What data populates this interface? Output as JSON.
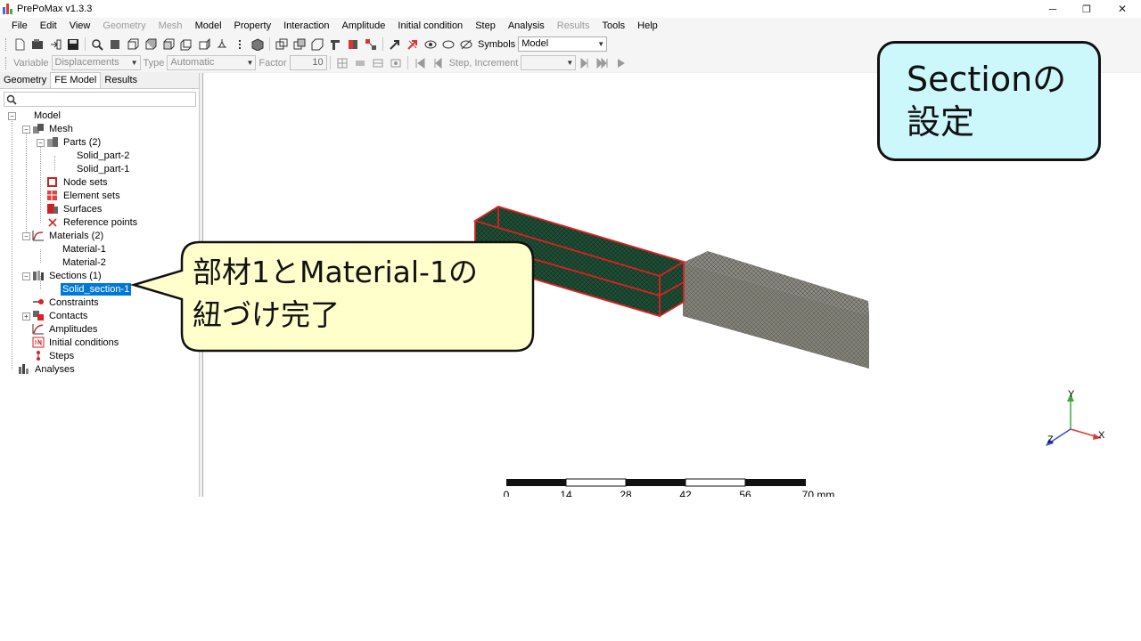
{
  "window": {
    "title": "PrePoMax v1.3.3",
    "minimize": "─",
    "maximize": "❐",
    "close": "✕"
  },
  "menu": [
    {
      "label": "File",
      "enabled": true
    },
    {
      "label": "Edit",
      "enabled": true
    },
    {
      "label": "View",
      "enabled": true
    },
    {
      "label": "Geometry",
      "enabled": false
    },
    {
      "label": "Mesh",
      "enabled": false
    },
    {
      "label": "Model",
      "enabled": true
    },
    {
      "label": "Property",
      "enabled": true
    },
    {
      "label": "Interaction",
      "enabled": true
    },
    {
      "label": "Amplitude",
      "enabled": true
    },
    {
      "label": "Initial condition",
      "enabled": true
    },
    {
      "label": "Step",
      "enabled": true
    },
    {
      "label": "Analysis",
      "enabled": true
    },
    {
      "label": "Results",
      "enabled": false
    },
    {
      "label": "Tools",
      "enabled": true
    },
    {
      "label": "Help",
      "enabled": true
    }
  ],
  "toolbar1": {
    "symbols_label": "Symbols",
    "symbols_value": "Model"
  },
  "toolbar2": {
    "variable_label": "Variable",
    "variable_value": "Displacements",
    "type_label": "Type",
    "type_value": "Automatic",
    "factor_label": "Factor",
    "factor_value": "10",
    "step_increment_label": "Step, Increment",
    "step_increment_value": ""
  },
  "tabs": [
    {
      "label": "Geometry",
      "active": false
    },
    {
      "label": "FE Model",
      "active": true
    },
    {
      "label": "Results",
      "active": false
    }
  ],
  "search": {
    "placeholder": ""
  },
  "tree": {
    "model": "Model",
    "mesh": "Mesh",
    "parts": "Parts (2)",
    "part1": "Solid_part-2",
    "part2": "Solid_part-1",
    "node_sets": "Node sets",
    "element_sets": "Element sets",
    "surfaces": "Surfaces",
    "reference_points": "Reference points",
    "materials": "Materials (2)",
    "material1": "Material-1",
    "material2": "Material-2",
    "sections": "Sections (1)",
    "section1": "Solid_section-1",
    "constraints": "Constraints",
    "contacts": "Contacts",
    "amplitudes": "Amplitudes",
    "initial_conditions": "Initial conditions",
    "steps": "Steps",
    "analyses": "Analyses"
  },
  "viewport": {
    "scale_ticks": [
      "0",
      "14",
      "28",
      "42",
      "56",
      "70 mm"
    ],
    "axes": {
      "x": "X",
      "y": "Y",
      "z": "Z"
    },
    "colors": {
      "mesh_part": "#1f4d36",
      "mesh_other": "#7a7a72",
      "selection": "#e02020"
    }
  },
  "annotations": {
    "section_title_line1": "Sectionの",
    "section_title_line2": "設定",
    "callout_line1": "部材1とMaterial-1の",
    "callout_line2": "紐づけ完了"
  }
}
